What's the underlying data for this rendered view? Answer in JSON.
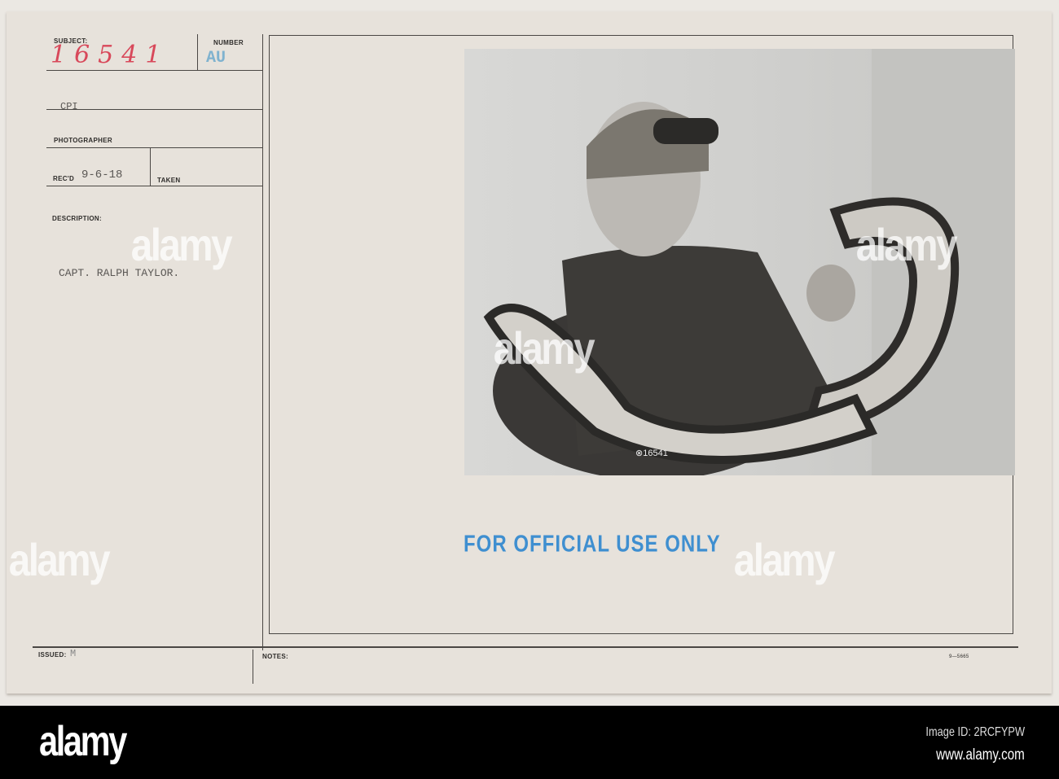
{
  "card": {
    "subject_label": "SUBJECT:",
    "subject_value": "16541",
    "number_label": "NUMBER",
    "number_value": "AU",
    "agency": "CPI",
    "photographer_label": "PHOTOGRAPHER",
    "recd_label": "REC'D",
    "recd_value": "9-6-18",
    "taken_label": "TAKEN",
    "description_label": "DESCRIPTION:",
    "description": "CAPT. RALPH TAYLOR.",
    "issued_label": "ISSUED:",
    "issued_value": "M",
    "notes_label": "NOTES:",
    "form_number": "9—5665",
    "photo_number": "⊗16541",
    "stamp": "FOR OFFICIAL USE ONLY",
    "stamp_color": "#3f8fd0",
    "handwriting_color": "#d8485a"
  },
  "watermark": {
    "text": "alamy",
    "image_id": "Image ID: 2RCFYPW",
    "url": "www.alamy.com"
  }
}
